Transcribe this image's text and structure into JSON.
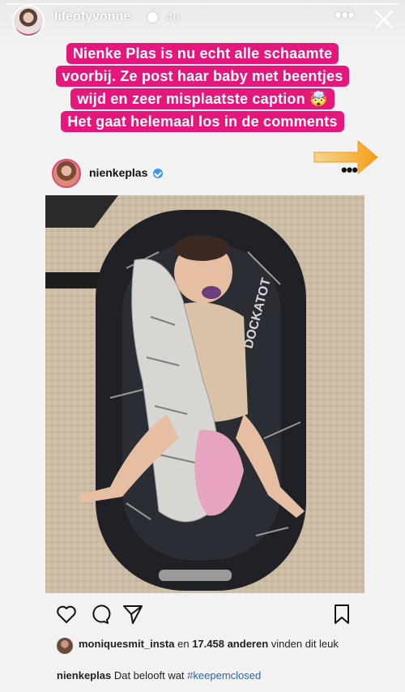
{
  "story": {
    "username": "lifeofyvonne",
    "time": "4u",
    "more_icon": "more-horizontal-icon",
    "close_icon": "close-icon"
  },
  "caption": {
    "lines": [
      "Nienke Plas is nu echt alle schaamte",
      "voorbij. Ze post haar baby met beentjes",
      "wijd en zeer misplaatste caption 🤯",
      "Het gaat helemaal los in de comments"
    ],
    "background_color": "#e5177c",
    "text_color": "#ffffff"
  },
  "arrow_sticker": {
    "icon": "arrow-right-icon",
    "color": "#f5a623"
  },
  "post": {
    "username": "nienkeplas",
    "verified": true,
    "more_icon": "more-horizontal-icon",
    "photo_label": "DOCKATOT",
    "likes": {
      "first_user": "moniquesmit_insta",
      "connector": "en",
      "count": "17.458",
      "others": "anderen",
      "suffix": "vinden dit leuk"
    },
    "caption": {
      "user": "nienkeplas",
      "text": "Dat belooft wat",
      "hashtag": "#keepemclosed"
    },
    "actions": {
      "like_icon": "heart-icon",
      "comment_icon": "comment-icon",
      "share_icon": "send-icon",
      "save_icon": "bookmark-icon"
    }
  },
  "colors": {
    "verified": "#3897f0",
    "hashtag": "#2a63b8"
  }
}
